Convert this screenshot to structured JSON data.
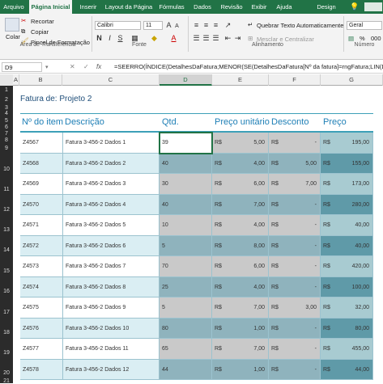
{
  "tabs": [
    "Arquivo",
    "Página Inicial",
    "Inserir",
    "Layout da Página",
    "Fórmulas",
    "Dados",
    "Revisão",
    "Exibir",
    "Ajuda",
    "Design"
  ],
  "ribbon": {
    "paste": "Colar",
    "cut": "Recortar",
    "copy": "Copiar",
    "format_painter": "Pincel de Formatação",
    "font_name": "Calibri",
    "font_size": "11",
    "bold": "N",
    "italic": "I",
    "underline": "S",
    "wrap_text": "Quebrar Texto Automaticamente",
    "merge_center": "Mesclar e Centralizar",
    "number_format": "Geral",
    "groups": {
      "clipboard": "Área de Transferência",
      "font": "Fonte",
      "alignment": "Alinhamento",
      "number": "Número"
    }
  },
  "formula_bar": {
    "name_box": "D9",
    "fx": "fx",
    "formula": "=SEERRO(ÍNDICE(DetalhesDaFatura;MENOR(SE(DetalhesDaFatura[Nº da fatura]=rngFatura;LIN(DetalhesDaFatura)"
  },
  "columns": [
    "A",
    "B",
    "C",
    "D",
    "E",
    "F",
    "G"
  ],
  "rows": [
    "1",
    "2",
    "3",
    "4",
    "5",
    "6",
    "7",
    "8",
    "9",
    "10",
    "11",
    "12",
    "13",
    "14",
    "15",
    "16",
    "17",
    "18",
    "19",
    "20",
    "21"
  ],
  "sheet": {
    "subtitle": "Fatura de: Projeto 2",
    "headers": [
      "Nº do item",
      "Descrição",
      "Qtd.",
      "Preço unitário",
      "Desconto",
      "Preço"
    ],
    "currency": "R$",
    "items": [
      {
        "item": "Z4567",
        "desc": "Fatura 3-456-2 Dados 1",
        "qty": "39",
        "unit": "5,00",
        "disc": "-",
        "price": "195,00"
      },
      {
        "item": "Z4568",
        "desc": "Fatura 3-456-2 Dados 2",
        "qty": "40",
        "unit": "4,00",
        "disc": "5,00",
        "price": "155,00"
      },
      {
        "item": "Z4569",
        "desc": "Fatura 3-456-2 Dados 3",
        "qty": "30",
        "unit": "6,00",
        "disc": "7,00",
        "price": "173,00"
      },
      {
        "item": "Z4570",
        "desc": "Fatura 3-456-2 Dados 4",
        "qty": "40",
        "unit": "7,00",
        "disc": "-",
        "price": "280,00"
      },
      {
        "item": "Z4571",
        "desc": "Fatura 3-456-2 Dados 5",
        "qty": "10",
        "unit": "4,00",
        "disc": "-",
        "price": "40,00"
      },
      {
        "item": "Z4572",
        "desc": "Fatura 3-456-2 Dados 6",
        "qty": "5",
        "unit": "8,00",
        "disc": "-",
        "price": "40,00"
      },
      {
        "item": "Z4573",
        "desc": "Fatura 3-456-2 Dados 7",
        "qty": "70",
        "unit": "6,00",
        "disc": "-",
        "price": "420,00"
      },
      {
        "item": "Z4574",
        "desc": "Fatura 3-456-2 Dados 8",
        "qty": "25",
        "unit": "4,00",
        "disc": "-",
        "price": "100,00"
      },
      {
        "item": "Z4575",
        "desc": "Fatura 3-456-2 Dados 9",
        "qty": "5",
        "unit": "7,00",
        "disc": "3,00",
        "price": "32,00"
      },
      {
        "item": "Z4576",
        "desc": "Fatura 3-456-2 Dados 10",
        "qty": "80",
        "unit": "1,00",
        "disc": "-",
        "price": "80,00"
      },
      {
        "item": "Z4577",
        "desc": "Fatura 3-456-2 Dados 11",
        "qty": "65",
        "unit": "7,00",
        "disc": "-",
        "price": "455,00"
      },
      {
        "item": "Z4578",
        "desc": "Fatura 3-456-2 Dados 12",
        "qty": "44",
        "unit": "1,00",
        "disc": "-",
        "price": "44,00"
      }
    ]
  },
  "colors": {
    "accent": "#217346",
    "header_text": "#1e7fb6",
    "band": "#daeef3",
    "qty_unit": "#c9c9c9",
    "qty_unit_band": "#8fb3bd",
    "price": "#a8cbd1",
    "price_band": "#5f9aa8"
  }
}
